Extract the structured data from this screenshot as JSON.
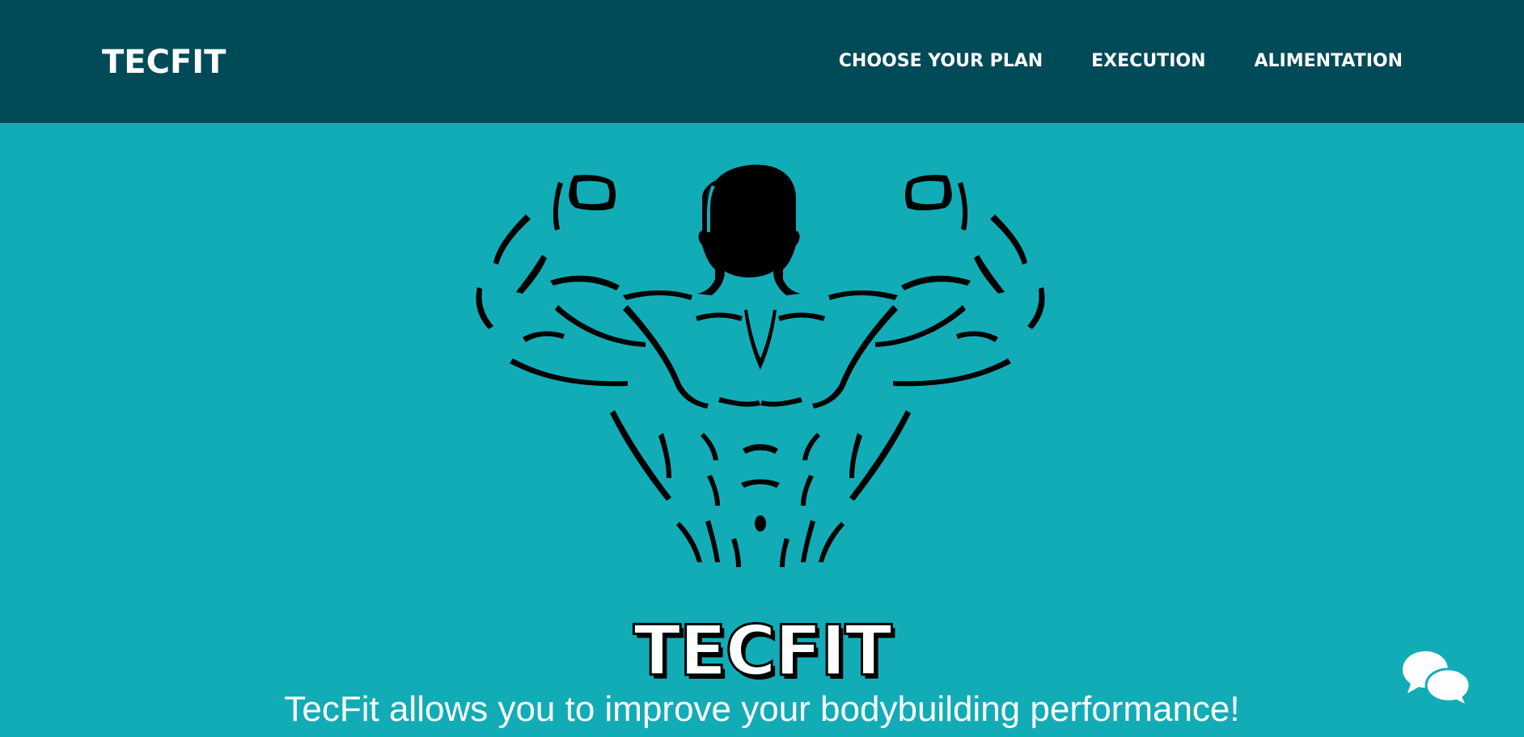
{
  "header": {
    "brand": "TECFIT",
    "nav": [
      {
        "label": "CHOOSE YOUR PLAN"
      },
      {
        "label": "EXECUTION"
      },
      {
        "label": "ALIMENTATION"
      }
    ]
  },
  "hero": {
    "title": "TECFIT",
    "subtitle": "TecFit allows you to improve your bodybuilding performance!",
    "figure_icon": "bodybuilder-silhouette-icon"
  },
  "chat": {
    "icon": "chat-bubbles-icon"
  },
  "colors": {
    "header_bg": "#014a57",
    "page_bg": "#12acb7",
    "text": "#ffffff",
    "accent_dark": "#000000"
  }
}
